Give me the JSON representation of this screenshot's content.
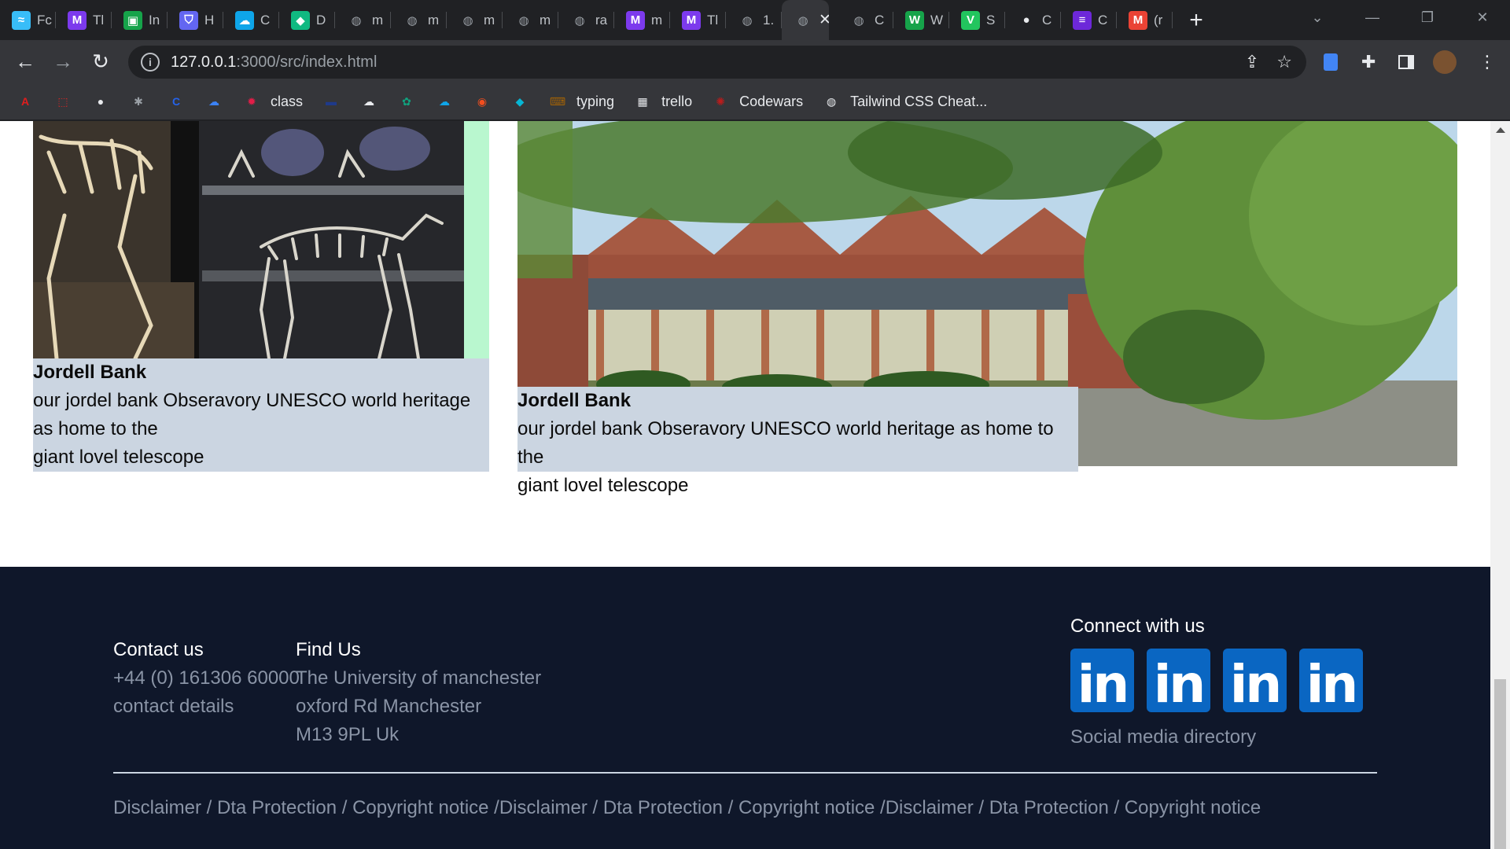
{
  "browser": {
    "tabs": [
      {
        "label": "Fc",
        "icon": "tailwind-icon",
        "color": "#38bdf8"
      },
      {
        "label": "Tl",
        "icon": "m-icon",
        "color": "#7c3aed"
      },
      {
        "label": "In",
        "icon": "image-icon",
        "color": "#16a34a"
      },
      {
        "label": "H",
        "icon": "shield-icon",
        "color": "#6366f1"
      },
      {
        "label": "C",
        "icon": "cloud-icon",
        "color": "#0ea5e9"
      },
      {
        "label": "D",
        "icon": "drop-icon",
        "color": "#10b981"
      },
      {
        "label": "m",
        "icon": "globe-icon",
        "color": "#9aa0a6"
      },
      {
        "label": "m",
        "icon": "globe-icon",
        "color": "#9aa0a6"
      },
      {
        "label": "m",
        "icon": "globe-icon",
        "color": "#9aa0a6"
      },
      {
        "label": "m",
        "icon": "globe-icon",
        "color": "#9aa0a6"
      },
      {
        "label": "ra",
        "icon": "globe-icon",
        "color": "#9aa0a6"
      },
      {
        "label": "m",
        "icon": "m-icon",
        "color": "#7c3aed"
      },
      {
        "label": "Tl",
        "icon": "m-icon",
        "color": "#7c3aed"
      },
      {
        "label": "1.",
        "icon": "globe-icon",
        "color": "#9aa0a6"
      },
      {
        "label": "",
        "icon": "globe-icon",
        "color": "#9aa0a6",
        "active": true
      },
      {
        "label": "C",
        "icon": "globe-icon",
        "color": "#9aa0a6"
      },
      {
        "label": "W",
        "icon": "w-icon",
        "color": "#16a34a"
      },
      {
        "label": "S",
        "icon": "vue-icon",
        "color": "#22c55e"
      },
      {
        "label": "C",
        "icon": "github-icon",
        "color": "#e8eaed"
      },
      {
        "label": "C",
        "icon": "list-icon",
        "color": "#6d28d9"
      },
      {
        "label": "(r",
        "icon": "gmail-icon",
        "color": "#ea4335"
      }
    ],
    "url_host": "127.0.0.1",
    "url_path": ":3000/src/index.html",
    "bookmarks": [
      {
        "label": "",
        "icon": "adobe-icon",
        "color": "#e11d1d"
      },
      {
        "label": "",
        "icon": "pdf-icon",
        "color": "#dc2626"
      },
      {
        "label": "",
        "icon": "github-icon",
        "color": "#e8eaed"
      },
      {
        "label": "",
        "icon": "bug-icon",
        "color": "#9aa0a6"
      },
      {
        "label": "",
        "icon": "c-icon",
        "color": "#2563eb"
      },
      {
        "label": "",
        "icon": "cloud-icon",
        "color": "#3b82f6"
      },
      {
        "label": "class",
        "icon": "gear-icon",
        "color": "#e11d48"
      },
      {
        "label": "",
        "icon": "bar-icon",
        "color": "#1e3a8a"
      },
      {
        "label": "",
        "icon": "cloud-upload-icon",
        "color": "#e8eaed"
      },
      {
        "label": "",
        "icon": "openai-icon",
        "color": "#10a37f"
      },
      {
        "label": "",
        "icon": "salesforce-icon",
        "color": "#0ea5e9"
      },
      {
        "label": "",
        "icon": "figma-icon",
        "color": "#f24e1e"
      },
      {
        "label": "",
        "icon": "diamond-icon",
        "color": "#06b6d4"
      },
      {
        "label": "typing",
        "icon": "keyboard-icon",
        "color": "#a16207"
      },
      {
        "label": "trello",
        "icon": "trello-icon",
        "color": "#e8eaed"
      },
      {
        "label": "Codewars",
        "icon": "codewars-icon",
        "color": "#b91c1c"
      },
      {
        "label": "Tailwind CSS Cheat...",
        "icon": "globe-icon",
        "color": "#e8eaed"
      }
    ]
  },
  "cards": [
    {
      "title": "Jordell Bank",
      "line1": "our jordel bank Obseravory UNESCO world heritage as home to the",
      "line2": "giant lovel telescope"
    },
    {
      "title": "Jordell Bank",
      "line1": "our jordel bank Obseravory UNESCO world heritage as home to the",
      "line2": "giant lovel telescope"
    }
  ],
  "footer": {
    "contact": {
      "heading": "Contact us",
      "phone": "+44 (0) 161306 60000",
      "details": "contact details"
    },
    "find": {
      "heading": "Find Us",
      "line1": "The University of manchester",
      "line2": "oxford Rd Manchester",
      "line3": "M13 9PL Uk"
    },
    "connect": {
      "heading": "Connect with us",
      "icon_text": "in",
      "directory": "Social media directory"
    },
    "legal": "Disclaimer / Dta Protection / Copyright notice /Disclaimer / Dta Protection / Copyright notice /Disclaimer / Dta Protection / Copyright notice"
  }
}
